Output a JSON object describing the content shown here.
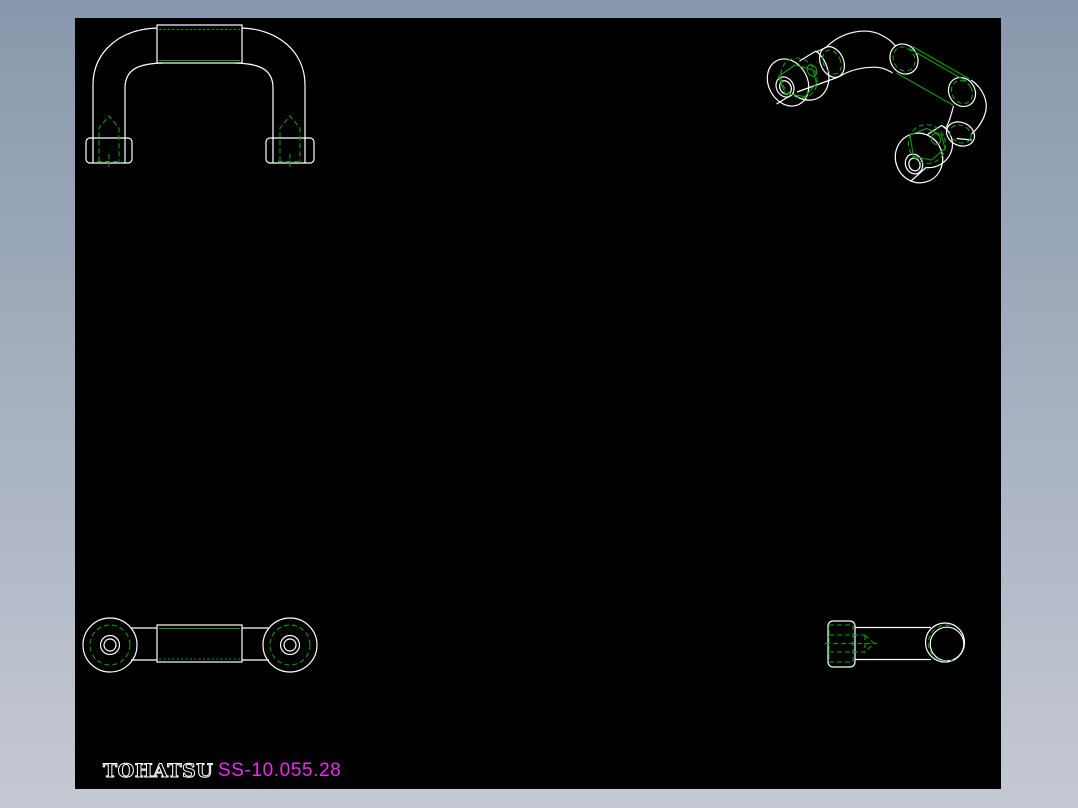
{
  "page": {
    "background_gradient_top": "#8898ac",
    "background_gradient_bottom": "#c5c9d3"
  },
  "viewer": {
    "canvas_background": "#000000",
    "line_color": "#ffffff",
    "feature_color": "#0f9b0f",
    "views": [
      {
        "id": "front-view",
        "description": "U-handle front elevation with mounting feet and hidden screws"
      },
      {
        "id": "isometric-view",
        "description": "U-handle 3D wireframe with flanged ends and hex nuts"
      },
      {
        "id": "top-view",
        "description": "U-handle plan view with round flanges and knurled grip"
      },
      {
        "id": "side-view",
        "description": "U-handle side view with foot, hidden screw and tube end"
      }
    ]
  },
  "title_block": {
    "manufacturer_logo": "TOHATSU",
    "logo_color": "#ffffff",
    "part_number": "SS-10.055.28",
    "part_number_color": "#ea2dea"
  }
}
